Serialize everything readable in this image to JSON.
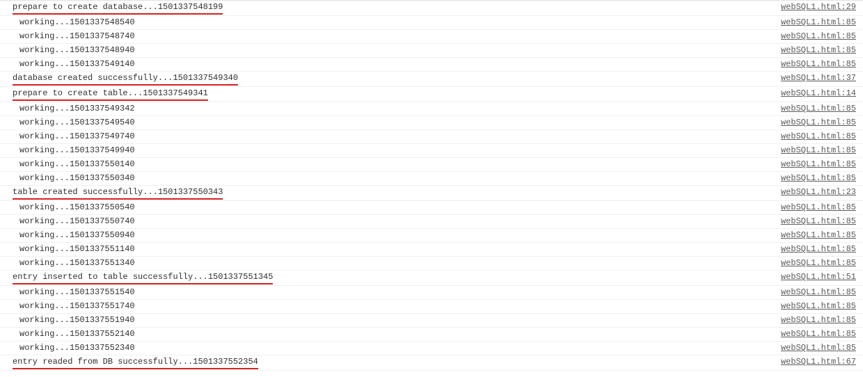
{
  "sourceFile": "webSQL1.html",
  "rows": [
    {
      "text": "prepare to create database...1501337548199",
      "line": 29,
      "indent": false,
      "highlight": true
    },
    {
      "text": "working...1501337548540",
      "line": 85,
      "indent": true,
      "highlight": false
    },
    {
      "text": "working...1501337548740",
      "line": 85,
      "indent": true,
      "highlight": false
    },
    {
      "text": "working...1501337548940",
      "line": 85,
      "indent": true,
      "highlight": false
    },
    {
      "text": "working...1501337549140",
      "line": 85,
      "indent": true,
      "highlight": false
    },
    {
      "text": "database created successfully...1501337549340",
      "line": 37,
      "indent": false,
      "highlight": true
    },
    {
      "text": "prepare to create table...1501337549341",
      "line": 14,
      "indent": false,
      "highlight": true
    },
    {
      "text": "working...1501337549342",
      "line": 85,
      "indent": true,
      "highlight": false
    },
    {
      "text": "working...1501337549540",
      "line": 85,
      "indent": true,
      "highlight": false
    },
    {
      "text": "working...1501337549740",
      "line": 85,
      "indent": true,
      "highlight": false
    },
    {
      "text": "working...1501337549940",
      "line": 85,
      "indent": true,
      "highlight": false
    },
    {
      "text": "working...1501337550140",
      "line": 85,
      "indent": true,
      "highlight": false
    },
    {
      "text": "working...1501337550340",
      "line": 85,
      "indent": true,
      "highlight": false
    },
    {
      "text": "table created successfully...1501337550343",
      "line": 23,
      "indent": false,
      "highlight": true
    },
    {
      "text": "working...1501337550540",
      "line": 85,
      "indent": true,
      "highlight": false
    },
    {
      "text": "working...1501337550740",
      "line": 85,
      "indent": true,
      "highlight": false
    },
    {
      "text": "working...1501337550940",
      "line": 85,
      "indent": true,
      "highlight": false
    },
    {
      "text": "working...1501337551140",
      "line": 85,
      "indent": true,
      "highlight": false
    },
    {
      "text": "working...1501337551340",
      "line": 85,
      "indent": true,
      "highlight": false
    },
    {
      "text": "entry inserted to table successfully...1501337551345",
      "line": 51,
      "indent": false,
      "highlight": true
    },
    {
      "text": "working...1501337551540",
      "line": 85,
      "indent": true,
      "highlight": false
    },
    {
      "text": "working...1501337551740",
      "line": 85,
      "indent": true,
      "highlight": false
    },
    {
      "text": "working...1501337551940",
      "line": 85,
      "indent": true,
      "highlight": false
    },
    {
      "text": "working...1501337552140",
      "line": 85,
      "indent": true,
      "highlight": false
    },
    {
      "text": "working...1501337552340",
      "line": 85,
      "indent": true,
      "highlight": false
    },
    {
      "text": "entry readed from DB successfully...1501337552354",
      "line": 67,
      "indent": false,
      "highlight": true
    }
  ]
}
